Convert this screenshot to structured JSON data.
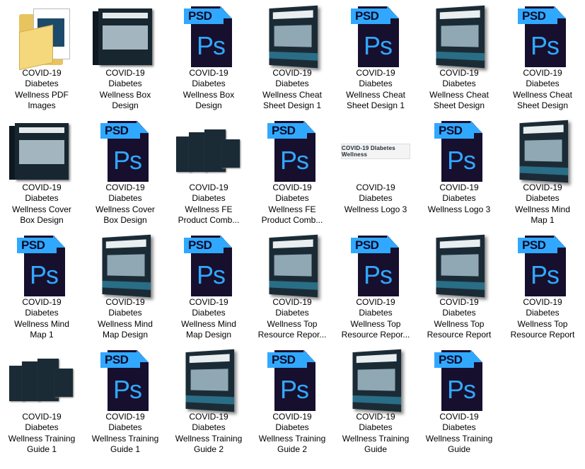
{
  "items": [
    {
      "label": "COVID-19\nDiabetes\nWellness PDF\nImages",
      "icon": "folder-icon",
      "kind": "folder"
    },
    {
      "label": "COVID-19\nDiabetes\nWellness Box\nDesign",
      "icon": "box-thumbnail",
      "kind": "box"
    },
    {
      "label": "COVID-19\nDiabetes\nWellness Box\nDesign",
      "icon": "psd-file-icon",
      "kind": "psd"
    },
    {
      "label": "COVID-19\nDiabetes\nWellness Cheat\nSheet Design 1",
      "icon": "book-thumbnail",
      "kind": "book"
    },
    {
      "label": "COVID-19\nDiabetes\nWellness Cheat\nSheet Design 1",
      "icon": "psd-file-icon",
      "kind": "psd"
    },
    {
      "label": "COVID-19\nDiabetes\nWellness Cheat\nSheet Design",
      "icon": "book-thumbnail",
      "kind": "book"
    },
    {
      "label": "COVID-19\nDiabetes\nWellness Cheat\nSheet Design",
      "icon": "psd-file-icon",
      "kind": "psd"
    },
    {
      "label": "COVID-19\nDiabetes\nWellness Cover\nBox Design",
      "icon": "box-thumbnail",
      "kind": "box"
    },
    {
      "label": "COVID-19\nDiabetes\nWellness Cover\nBox Design",
      "icon": "psd-file-icon",
      "kind": "psd"
    },
    {
      "label": "COVID-19\nDiabetes\nWellness FE\nProduct Comb...",
      "icon": "combo-thumbnail",
      "kind": "combo"
    },
    {
      "label": "COVID-19\nDiabetes\nWellness FE\nProduct Comb...",
      "icon": "psd-file-icon",
      "kind": "psd"
    },
    {
      "label": "COVID-19\nDiabetes\nWellness Logo 3",
      "icon": "logo-thumbnail",
      "kind": "logo"
    },
    {
      "label": "COVID-19\nDiabetes\nWellness Logo 3",
      "icon": "psd-file-icon",
      "kind": "psd"
    },
    {
      "label": "COVID-19\nDiabetes\nWellness Mind\nMap 1",
      "icon": "book-thumbnail",
      "kind": "book"
    },
    {
      "label": "COVID-19\nDiabetes\nWellness Mind\nMap 1",
      "icon": "psd-file-icon",
      "kind": "psd"
    },
    {
      "label": "COVID-19\nDiabetes\nWellness Mind\nMap Design",
      "icon": "book-thumbnail",
      "kind": "book"
    },
    {
      "label": "COVID-19\nDiabetes\nWellness Mind\nMap Design",
      "icon": "psd-file-icon",
      "kind": "psd"
    },
    {
      "label": "COVID-19\nDiabetes\nWellness Top\nResource Repor...",
      "icon": "book-thumbnail",
      "kind": "book"
    },
    {
      "label": "COVID-19\nDiabetes\nWellness Top\nResource Repor...",
      "icon": "psd-file-icon",
      "kind": "psd"
    },
    {
      "label": "COVID-19\nDiabetes\nWellness Top\nResource Report",
      "icon": "book-thumbnail",
      "kind": "book"
    },
    {
      "label": "COVID-19\nDiabetes\nWellness Top\nResource Report",
      "icon": "psd-file-icon",
      "kind": "psd"
    },
    {
      "label": "COVID-19\nDiabetes\nWellness Training\nGuide 1",
      "icon": "combo-thumbnail",
      "kind": "combo"
    },
    {
      "label": "COVID-19\nDiabetes\nWellness Training\nGuide 1",
      "icon": "psd-file-icon",
      "kind": "psd"
    },
    {
      "label": "COVID-19\nDiabetes\nWellness Training\nGuide 2",
      "icon": "book-thumbnail",
      "kind": "book"
    },
    {
      "label": "COVID-19\nDiabetes\nWellness Training\nGuide 2",
      "icon": "psd-file-icon",
      "kind": "psd"
    },
    {
      "label": "COVID-19\nDiabetes\nWellness Training\nGuide",
      "icon": "book-thumbnail",
      "kind": "book"
    },
    {
      "label": "COVID-19\nDiabetes\nWellness Training\nGuide",
      "icon": "psd-file-icon",
      "kind": "psd"
    }
  ],
  "psd_badge": "PSD",
  "psd_mark": "Ps",
  "logo_text": "COVID-19 DIabetes Wellness",
  "colors": {
    "psd_blue": "#31a8ff",
    "psd_dark": "#170f2e",
    "folder": "#e8c35e",
    "cover_dark": "#1b2b36"
  }
}
